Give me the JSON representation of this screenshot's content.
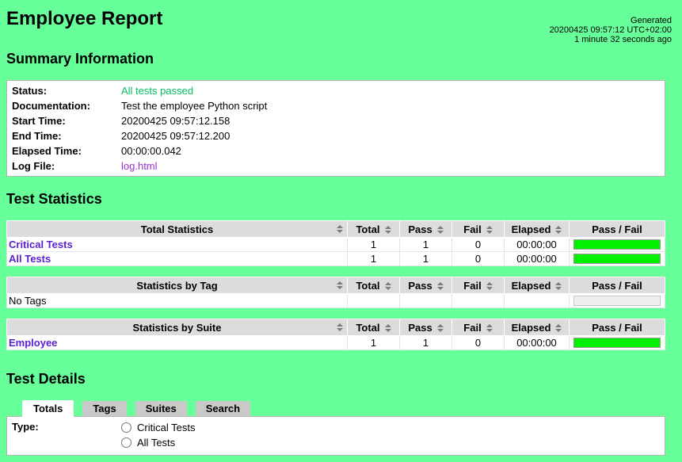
{
  "header": {
    "title": "Employee Report",
    "generated_label": "Generated",
    "generated_time": "20200425 09:57:12 UTC+02:00",
    "generated_ago": "1 minute 32 seconds ago"
  },
  "summary": {
    "heading": "Summary Information",
    "status_label": "Status:",
    "status_value": "All tests passed",
    "documentation_label": "Documentation:",
    "documentation_value": "Test the employee Python script",
    "start_time_label": "Start Time:",
    "start_time_value": "20200425 09:57:12.158",
    "end_time_label": "End Time:",
    "end_time_value": "20200425 09:57:12.200",
    "elapsed_label": "Elapsed Time:",
    "elapsed_value": "00:00:00.042",
    "log_file_label": "Log File:",
    "log_file_value": "log.html"
  },
  "statistics": {
    "heading": "Test Statistics",
    "col_total": "Total",
    "col_pass": "Pass",
    "col_fail": "Fail",
    "col_elapsed": "Elapsed",
    "col_passfail": "Pass / Fail",
    "total_table": {
      "title": "Total Statistics",
      "rows": [
        {
          "name": "Critical Tests",
          "total": "1",
          "pass": "1",
          "fail": "0",
          "elapsed": "00:00:00",
          "pass_pct": 100
        },
        {
          "name": "All Tests",
          "total": "1",
          "pass": "1",
          "fail": "0",
          "elapsed": "00:00:00",
          "pass_pct": 100
        }
      ]
    },
    "tag_table": {
      "title": "Statistics by Tag",
      "rows": [
        {
          "name": "No Tags",
          "total": "",
          "pass": "",
          "fail": "",
          "elapsed": "",
          "pass_pct": null
        }
      ]
    },
    "suite_table": {
      "title": "Statistics by Suite",
      "rows": [
        {
          "name": "Employee",
          "total": "1",
          "pass": "1",
          "fail": "0",
          "elapsed": "00:00:00",
          "pass_pct": 100
        }
      ]
    }
  },
  "details": {
    "heading": "Test Details",
    "tabs": [
      {
        "label": "Totals",
        "active": true
      },
      {
        "label": "Tags",
        "active": false
      },
      {
        "label": "Suites",
        "active": false
      },
      {
        "label": "Search",
        "active": false
      }
    ],
    "type_label": "Type:",
    "radio_options": [
      {
        "label": "Critical Tests",
        "checked": false
      },
      {
        "label": "All Tests",
        "checked": false
      }
    ]
  },
  "colors": {
    "page_background": "#66ff99",
    "pass_bar": "#00f000",
    "status_pass_text": "#00c060",
    "stat_link": "#5a1ed2",
    "log_link": "#9933cc",
    "table_header_bg": "#dcdcdc",
    "inactive_tab_bg": "#c9c9c9"
  }
}
